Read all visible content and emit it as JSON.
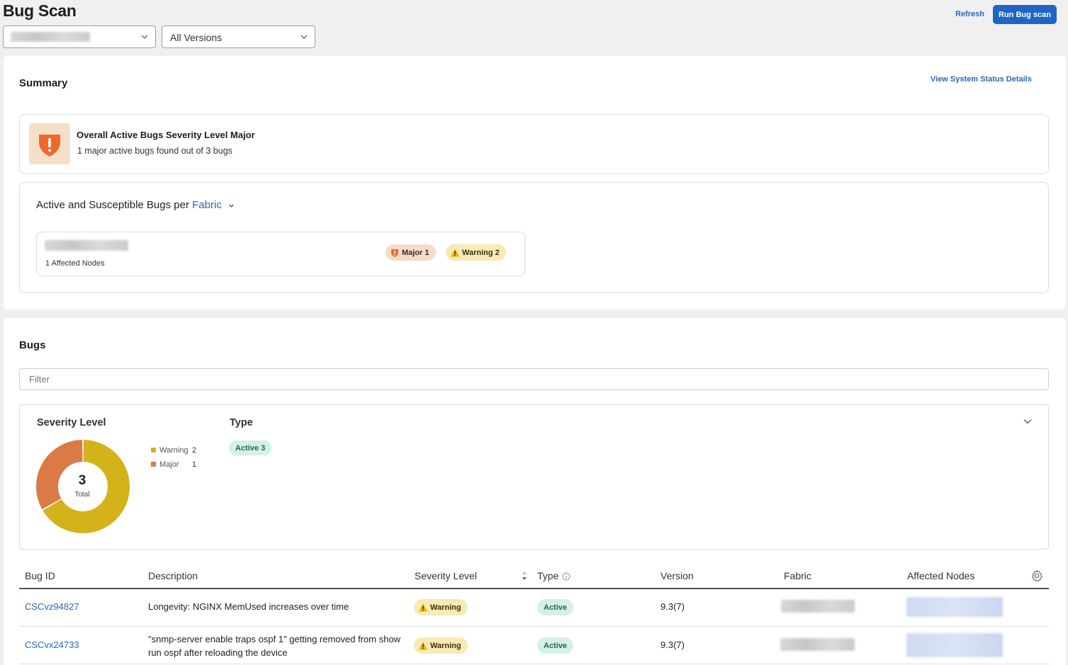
{
  "header": {
    "title": "Bug Scan",
    "site_select": {
      "value": ""
    },
    "version_select": {
      "value": "All Versions"
    },
    "refresh_label": "Refresh",
    "run_scan_label": "Run Bug scan",
    "accent_color": "#1f66c4"
  },
  "summary": {
    "title": "Summary",
    "details_link": "View System Status Details",
    "overall": {
      "title": "Overall Active Bugs Severity Level Major",
      "subtitle": "1 major active bugs found out of 3 bugs",
      "icon": "major-shield-icon"
    },
    "per_fabric": {
      "title": "Active and Susceptible Bugs per",
      "group_by": "Fabric",
      "fabric_card": {
        "name": "",
        "affected": "1 Affected Nodes",
        "major_label": "Major 1",
        "warning_label": "Warning 2"
      }
    }
  },
  "bugs": {
    "title": "Bugs",
    "filter_placeholder": "Filter",
    "severity_title": "Severity Level",
    "type_title": "Type",
    "donut": {
      "total": "3",
      "total_label": "Total"
    },
    "legend": [
      {
        "label": "Warning",
        "count": "2",
        "color": "#d4b21a"
      },
      {
        "label": "Major",
        "count": "1",
        "color": "#dc7a45"
      }
    ],
    "type_pill": "Active 3",
    "table": {
      "columns": [
        "Bug ID",
        "Description",
        "Severity Level",
        "Type",
        "Version",
        "Fabric",
        "Affected Nodes"
      ],
      "rows": [
        {
          "id": "CSCvz94827",
          "desc": "Longevity: NGINX MemUsed increases over time",
          "severity": "Warning",
          "type": "Active",
          "version": "9.3(7)"
        },
        {
          "id": "CSCvx24733",
          "desc": "\"snmp-server enable traps ospf 1\" getting removed from show run ospf after reloading the device",
          "severity": "Warning",
          "type": "Active",
          "version": "9.3(7)"
        }
      ]
    }
  },
  "chart_data": {
    "type": "pie",
    "categories": [
      "Warning",
      "Major"
    ],
    "values": [
      2,
      1
    ],
    "title": "Severity Level"
  }
}
